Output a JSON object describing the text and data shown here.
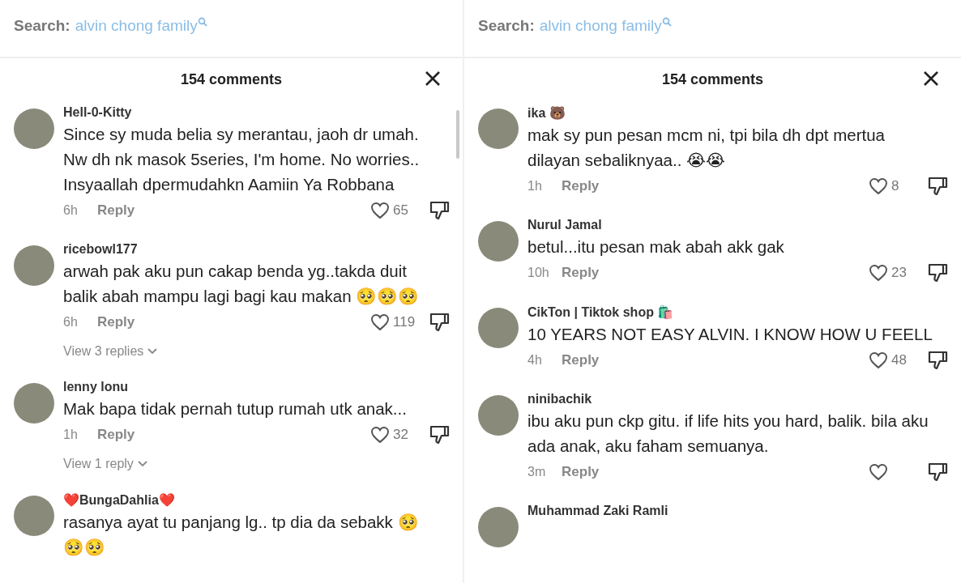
{
  "panels": [
    {
      "search": {
        "label": "Search:",
        "query": "alvin chong family"
      },
      "title": "154 comments",
      "comments": [
        {
          "user": "Hell-0-Kitty",
          "text": "Since sy muda belia sy merantau, jaoh dr umah. Nw dh nk masok 5series, I'm home. No worries.. Insyaallah dpermudahkn Aamiin Ya Robbana",
          "time": "6h",
          "reply": "Reply",
          "likes": "65"
        },
        {
          "user": "ricebowl177",
          "text": "arwah pak aku pun cakap benda yg..takda duit balik abah mampu lagi bagi kau makan 🥺🥺🥺",
          "time": "6h",
          "reply": "Reply",
          "likes": "119",
          "view_replies": "View 3 replies"
        },
        {
          "user": "lenny lonu",
          "text": "Mak bapa tidak pernah tutup rumah utk anak...",
          "time": "1h",
          "reply": "Reply",
          "likes": "32",
          "view_replies": "View 1 reply"
        },
        {
          "user": "❤️BungaDahlia❤️",
          "text": "rasanya ayat tu panjang lg.. tp dia da sebakk 🥺 🥺🥺"
        }
      ]
    },
    {
      "search": {
        "label": "Search:",
        "query": "alvin chong family"
      },
      "title": "154 comments",
      "comments": [
        {
          "user": "ika 🐻",
          "text": "mak sy pun pesan mcm ni, tpi bila dh dpt mertua dilayan sebaliknyaa.. 😭😭",
          "time": "1h",
          "reply": "Reply",
          "likes": "8"
        },
        {
          "user": "Nurul Jamal",
          "text": "betul...itu pesan mak abah akk gak",
          "time": "10h",
          "reply": "Reply",
          "likes": "23"
        },
        {
          "user": "CikTon  | Tiktok shop 🛍️",
          "text": "10 YEARS NOT EASY ALVIN. I KNOW HOW U FEELL",
          "time": "4h",
          "reply": "Reply",
          "likes": "48"
        },
        {
          "user": "ninibachik",
          "text": "ibu aku pun ckp gitu. if life hits you hard, balik. bila aku ada anak, aku faham semuanya.",
          "time": "3m",
          "reply": "Reply"
        },
        {
          "user": "Muhammad Zaki Ramli"
        }
      ]
    }
  ]
}
